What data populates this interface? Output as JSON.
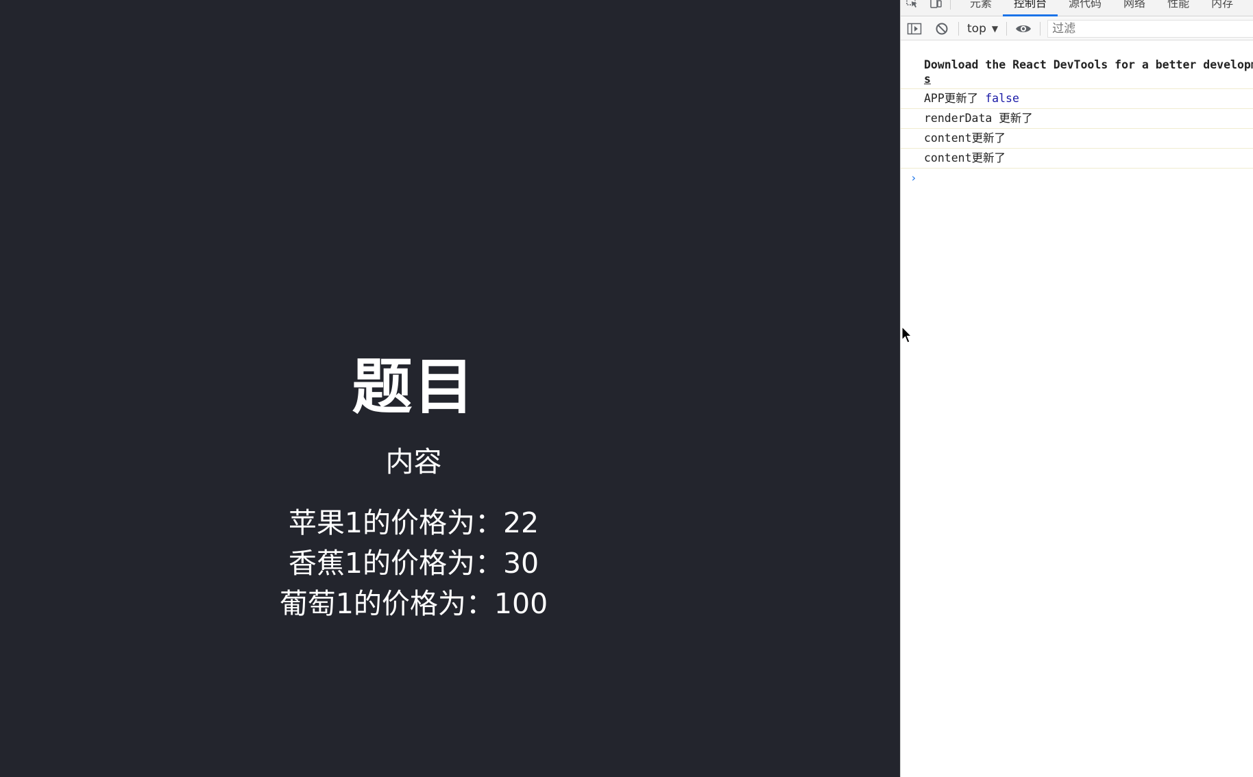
{
  "app": {
    "title": "题目",
    "subtitle": "内容",
    "price_items": [
      {
        "text": "苹果1的价格为：22"
      },
      {
        "text": "香蕉1的价格为：30"
      },
      {
        "text": "葡萄1的价格为：100"
      }
    ]
  },
  "devtools": {
    "tabs": [
      {
        "label": "元素",
        "active": false
      },
      {
        "label": "控制台",
        "active": true
      },
      {
        "label": "源代码",
        "active": false
      },
      {
        "label": "网络",
        "active": false
      },
      {
        "label": "性能",
        "active": false
      },
      {
        "label": "内存",
        "active": false
      }
    ],
    "toolbar": {
      "context": "top",
      "filter_placeholder": "过滤"
    },
    "console": {
      "lines": {
        "devtools_notice": "Download the React DevTools for a better development experience",
        "devtools_notice_link": "s",
        "app_update_prefix": "APP更新了",
        "app_update_value": "false",
        "render_data": "renderData 更新了",
        "content_1": "content更新了",
        "content_2": "content更新了"
      },
      "prompt": "›"
    }
  },
  "colors": {
    "app_background": "#23252d",
    "app_text": "#ffffff",
    "active_tab_underline": "#1a73e8",
    "boolean_value": "#1a1aa6"
  },
  "icons": {
    "inspect": "inspect-element-icon",
    "device": "device-toolbar-icon",
    "sidebar": "sidebar-toggle-icon",
    "clear": "clear-console-icon",
    "eye": "live-expression-eye-icon",
    "cursor": "mouse-pointer-icon"
  }
}
